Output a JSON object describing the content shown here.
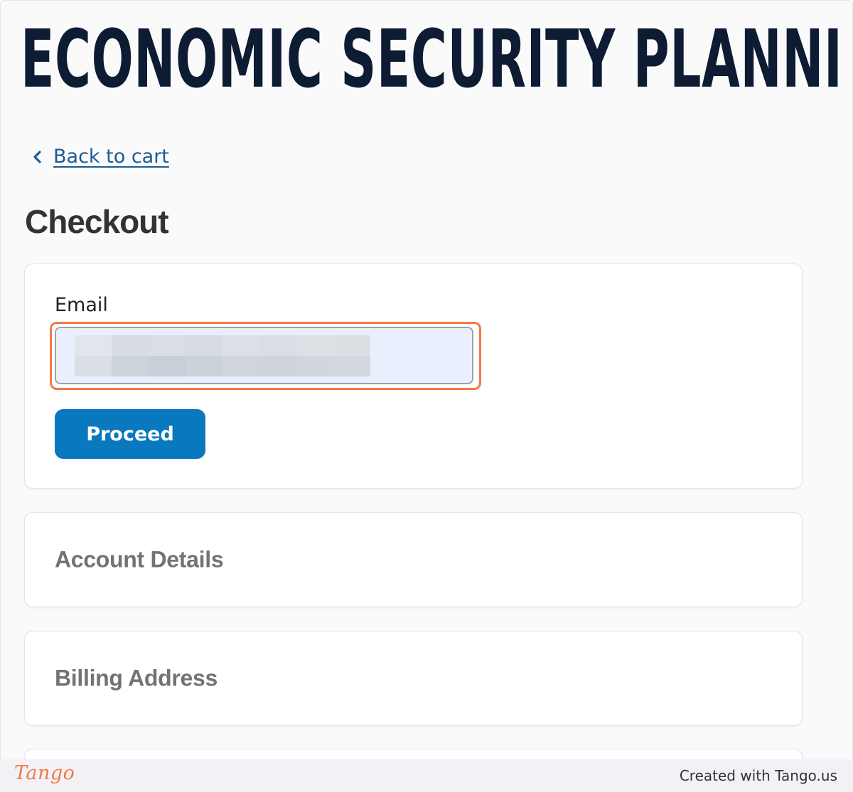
{
  "header": {
    "site_title": "ECONOMIC SECURITY PLANNI"
  },
  "nav": {
    "back_label": "Back to cart",
    "back_icon": "chevron-left-icon"
  },
  "checkout": {
    "title": "Checkout",
    "email_section": {
      "label": "Email",
      "value": "",
      "value_redacted": true,
      "proceed_label": "Proceed"
    },
    "sections": [
      {
        "title": "Account Details"
      },
      {
        "title": "Billing Address"
      }
    ]
  },
  "footer": {
    "brand": "Tango",
    "credit": "Created with Tango.us"
  },
  "colors": {
    "title_navy": "#0d1b33",
    "link_blue": "#1a5b96",
    "button_blue": "#0a78be",
    "highlight_orange": "#f47a46",
    "input_autofill_bg": "#e8f0fe",
    "section_gray": "#737373"
  }
}
